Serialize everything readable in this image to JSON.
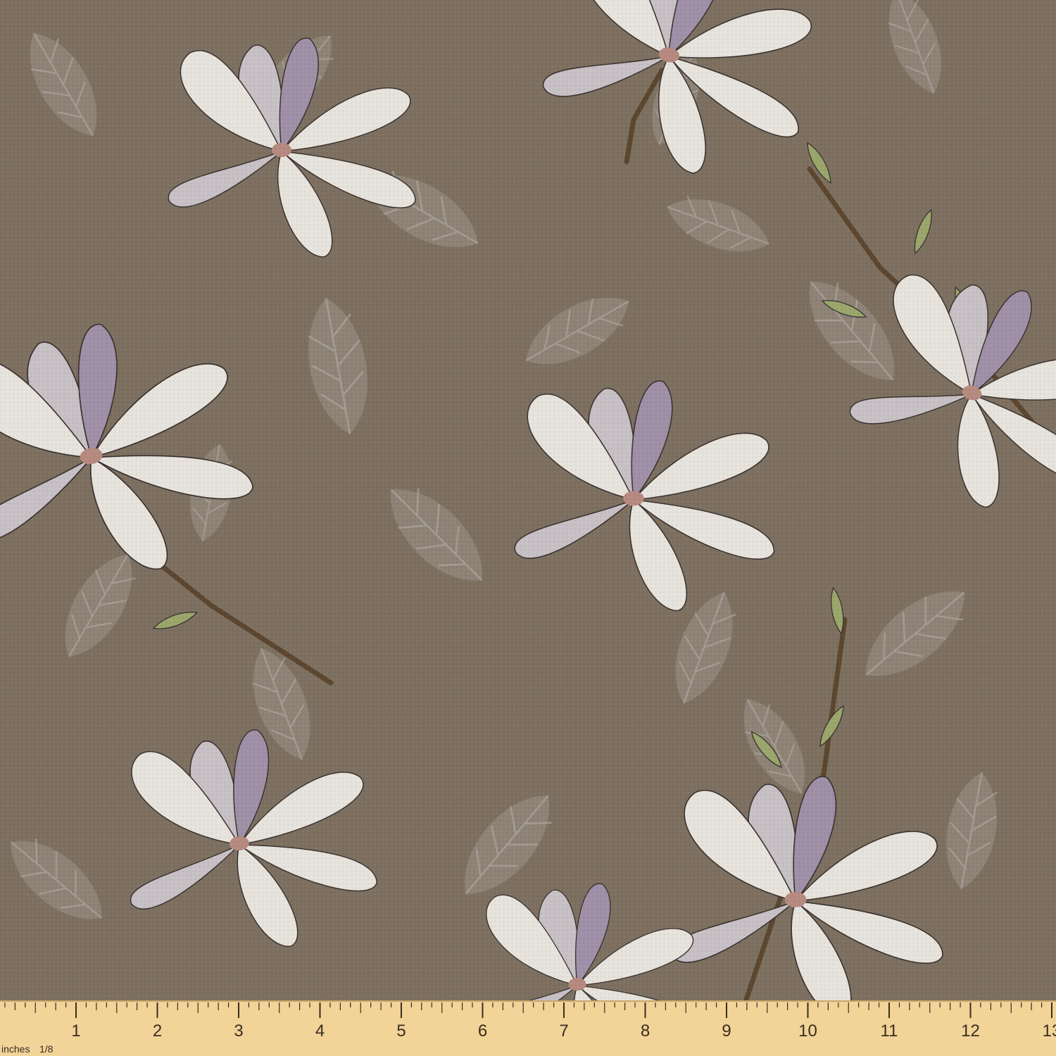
{
  "fabric": {
    "background_color": "#7d7060",
    "leaf_print_color": "#b3aca4",
    "petal_light_color": "#e6e3dc",
    "petal_lilac_color": "#9f90a8",
    "petal_shadow_color": "#c7c0c5",
    "stem_color": "#5c4630",
    "green_leaf_color": "#9aa66b",
    "center_color": "#b78a80",
    "weave_texture": true
  },
  "ruler": {
    "background_color": "#f2d398",
    "tick_color": "#3a2e1f",
    "unit_label": "inches",
    "fraction_label": "1/8",
    "numbers": [
      "1",
      "2",
      "3",
      "4",
      "5",
      "6",
      "7",
      "8",
      "9",
      "10",
      "11",
      "12",
      "13"
    ]
  }
}
